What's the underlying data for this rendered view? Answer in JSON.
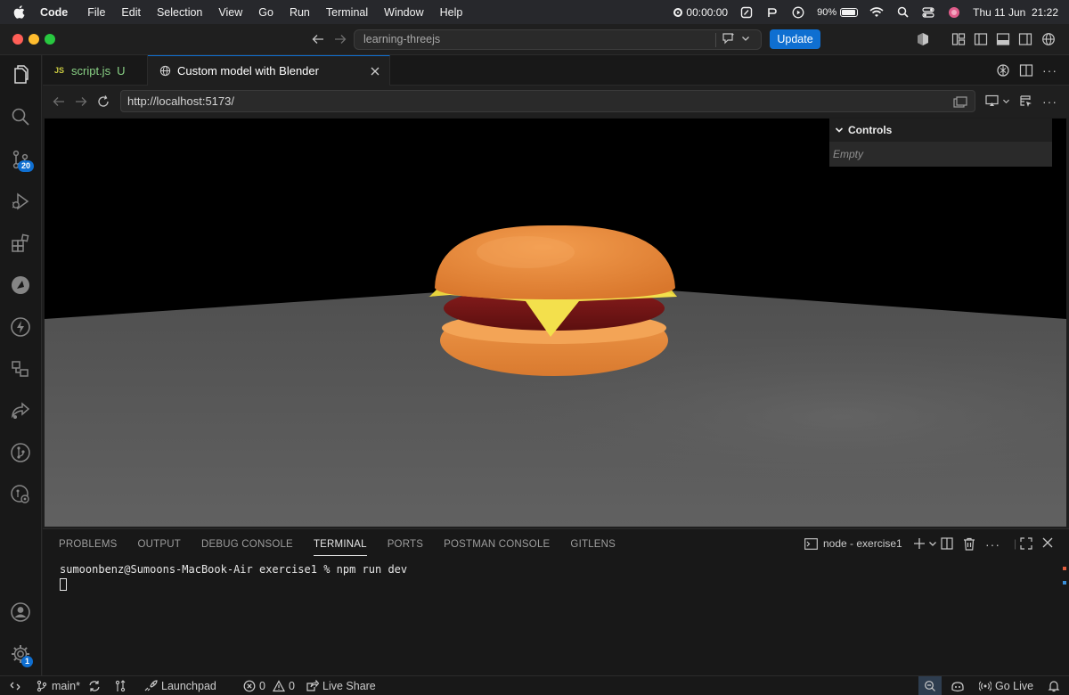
{
  "menubar": {
    "app": "Code",
    "items": [
      "File",
      "Edit",
      "Selection",
      "View",
      "Go",
      "Run",
      "Terminal",
      "Window",
      "Help"
    ],
    "timer": "00:00:00",
    "battery": "90%",
    "datetime": "Thu 11 Jun  21:22"
  },
  "titlebar": {
    "search": "learning-threejs",
    "update_label": "Update"
  },
  "activitybar": {
    "scm_badge": "20",
    "settings_badge": "1"
  },
  "tabs": [
    {
      "icon": "JS",
      "label": "script.js",
      "status": "U"
    },
    {
      "label": "Custom model with Blender"
    }
  ],
  "browser": {
    "url": "http://localhost:5173/"
  },
  "controls": {
    "title": "Controls",
    "empty": "Empty"
  },
  "panel": {
    "tabs": [
      "PROBLEMS",
      "OUTPUT",
      "DEBUG CONSOLE",
      "TERMINAL",
      "PORTS",
      "POSTMAN CONSOLE",
      "GITLENS"
    ],
    "active_tab": "TERMINAL",
    "terminal_name": "node - exercise1",
    "prompt_line": "sumoonbenz@Sumoons-MacBook-Air exercise1 % npm run dev"
  },
  "statusbar": {
    "branch": "main*",
    "launchpad": "Launchpad",
    "errors": "0",
    "warnings": "0",
    "live_share": "Live Share",
    "go_live": "Go Live"
  },
  "colors": {
    "accent": "#0f6fd1",
    "bun": "#ee9140",
    "patty": "#6b1414",
    "cheese": "#f2df4a",
    "floor": "#5e5e5e"
  }
}
